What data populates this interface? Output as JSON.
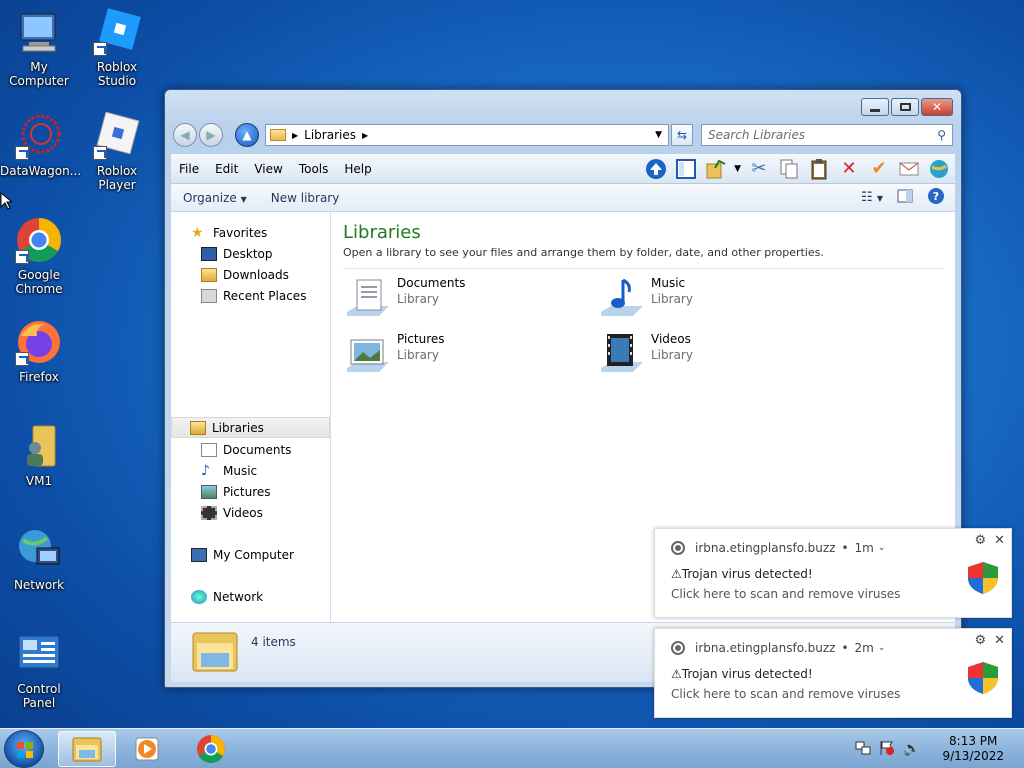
{
  "desktop": {
    "icons": [
      {
        "label": "My Computer"
      },
      {
        "label": "Roblox Studio"
      },
      {
        "label": "DataWagon..."
      },
      {
        "label": "Roblox Player"
      },
      {
        "label": "Google Chrome"
      },
      {
        "label": "Firefox"
      },
      {
        "label": "VM1"
      },
      {
        "label": "Network"
      },
      {
        "label": "Control Panel"
      }
    ]
  },
  "explorer": {
    "address": {
      "segment": "Libraries"
    },
    "search": {
      "placeholder": "Search Libraries"
    },
    "menu": [
      "File",
      "Edit",
      "View",
      "Tools",
      "Help"
    ],
    "commands": {
      "organize": "Organize",
      "new_library": "New library"
    },
    "nav": {
      "favorites": "Favorites",
      "desktop": "Desktop",
      "downloads": "Downloads",
      "recent": "Recent Places",
      "libraries": "Libraries",
      "documents": "Documents",
      "music": "Music",
      "pictures": "Pictures",
      "videos": "Videos",
      "computer": "My Computer",
      "network": "Network"
    },
    "content": {
      "title": "Libraries",
      "subtitle": "Open a library to see your files and arrange them by folder, date, and other properties.",
      "libraries": [
        {
          "name": "Documents",
          "type": "Library"
        },
        {
          "name": "Music",
          "type": "Library"
        },
        {
          "name": "Pictures",
          "type": "Library"
        },
        {
          "name": "Videos",
          "type": "Library"
        }
      ]
    },
    "details": {
      "count": "4 items"
    }
  },
  "notifications": [
    {
      "source": "irbna.etingplansfo.buzz",
      "time": "1m",
      "title": "⚠Trojan virus detected!",
      "body": "Click here to scan and remove viruses"
    },
    {
      "source": "irbna.etingplansfo.buzz",
      "time": "2m",
      "title": "⚠Trojan virus detected!",
      "body": "Click here to scan and remove viruses"
    }
  ],
  "taskbar": {
    "time": "8:13 PM",
    "date": "9/13/2022"
  }
}
